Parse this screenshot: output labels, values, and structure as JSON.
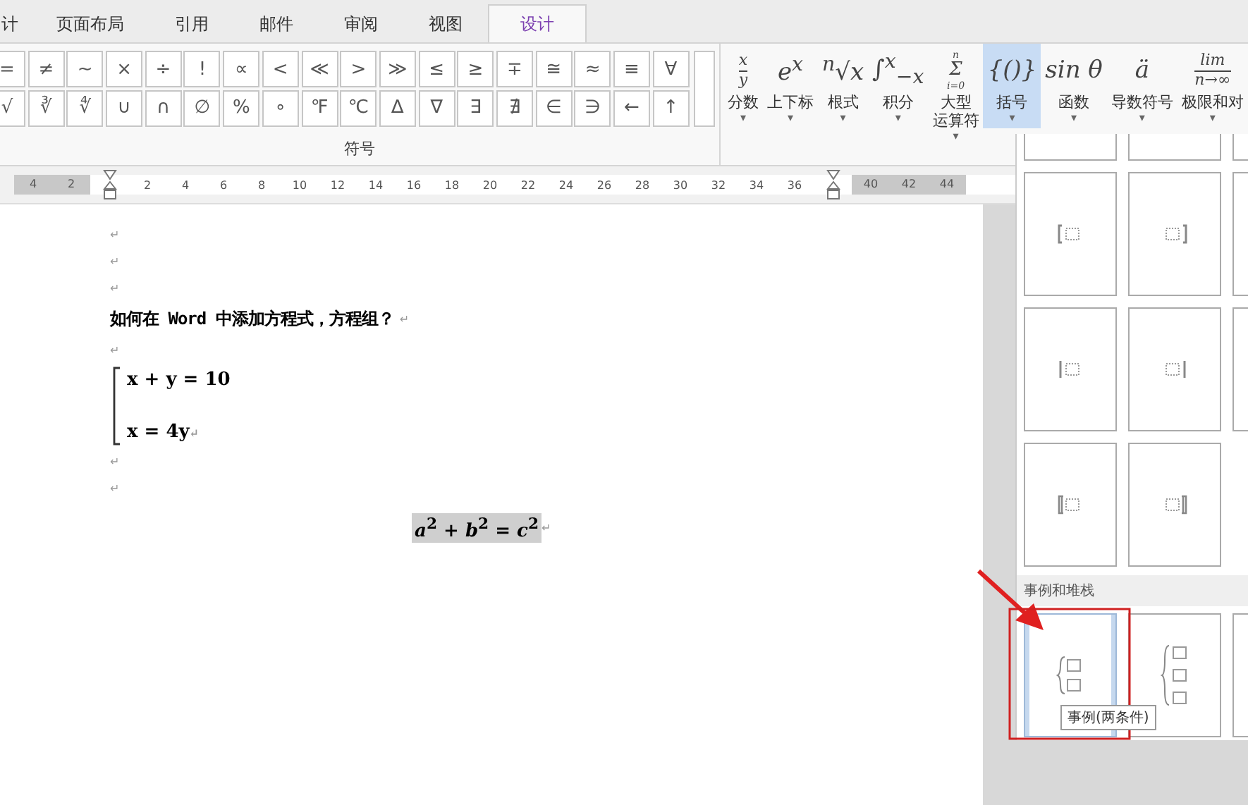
{
  "tabs": [
    {
      "label": "计",
      "selected": false
    },
    {
      "label": "页面布局",
      "selected": false
    },
    {
      "label": "引用",
      "selected": false
    },
    {
      "label": "邮件",
      "selected": false
    },
    {
      "label": "审阅",
      "selected": false
    },
    {
      "label": "视图",
      "selected": false
    },
    {
      "label": "设计",
      "selected": true
    }
  ],
  "symbols": {
    "rows": [
      [
        "=",
        "≠",
        "~",
        "×",
        "÷",
        "!",
        "∝",
        "<",
        "≪",
        ">",
        "≫",
        "≤",
        "≥",
        "∓",
        "≅",
        "≈",
        "≡",
        "∀"
      ],
      [
        "√",
        "∛",
        "∜",
        "∪",
        "∩",
        "∅",
        "%",
        "∘",
        "℉",
        "℃",
        "∆",
        "∇",
        "∃",
        "∄",
        "∈",
        "∋",
        "←",
        "↑"
      ]
    ],
    "group_label": "符号"
  },
  "structures": [
    {
      "kind": "fraction",
      "top": "x",
      "bottom": "y",
      "label": [
        "分数"
      ],
      "caret": "▾",
      "selected": false
    },
    {
      "kind": "inline",
      "glyph": "e$^{x}$",
      "label": [
        "上下标"
      ],
      "caret": "▾",
      "selected": false
    },
    {
      "kind": "inline",
      "glyph": "$^{n}$√x",
      "label": [
        "根式"
      ],
      "caret": "▾",
      "selected": false
    },
    {
      "kind": "inline",
      "glyph": "∫$^{x}$$_{−x}$",
      "label": [
        "积分"
      ],
      "caret": "▾",
      "selected": false
    },
    {
      "kind": "stack",
      "top": "n",
      "mid": "Σ",
      "bottom": "i=0",
      "label": [
        "大型",
        "运算符"
      ],
      "caret": "▾",
      "selected": false
    },
    {
      "kind": "inline",
      "glyph": "{()}",
      "label": [
        "括号"
      ],
      "caret": "▾",
      "selected": true
    },
    {
      "kind": "inline",
      "glyph": "sin θ",
      "label": [
        "函数"
      ],
      "caret": "▾",
      "selected": false
    },
    {
      "kind": "inline",
      "glyph": "ä",
      "label": [
        "导数符号"
      ],
      "caret": "▾",
      "selected": false
    },
    {
      "kind": "fraction",
      "top": "lim",
      "bottom": "n→∞",
      "label": [
        "极限和对"
      ],
      "caret": "▾",
      "selected": false
    }
  ],
  "ruler": [
    {
      "label": "4"
    },
    {
      "label": "2"
    },
    {
      "kind": "marker"
    },
    {
      "label": "2"
    },
    {
      "label": "4"
    },
    {
      "label": "6"
    },
    {
      "label": "8"
    },
    {
      "label": "10"
    },
    {
      "label": "12"
    },
    {
      "label": "14"
    },
    {
      "label": "16"
    },
    {
      "label": "18"
    },
    {
      "label": "20"
    },
    {
      "label": "22"
    },
    {
      "label": "24"
    },
    {
      "label": "26"
    },
    {
      "label": "28"
    },
    {
      "label": "30"
    },
    {
      "label": "32"
    },
    {
      "label": "34"
    },
    {
      "label": "36"
    },
    {
      "kind": "marker"
    },
    {
      "label": "40"
    },
    {
      "label": "42"
    },
    {
      "label": "44"
    }
  ],
  "document": [
    {
      "kind": "empty",
      "mark": "↵"
    },
    {
      "kind": "empty",
      "mark": "↵"
    },
    {
      "kind": "empty",
      "mark": "↵"
    },
    {
      "kind": "heading",
      "text": "如何在 Word 中添加方程式，方程组？",
      "mark": "↵"
    },
    {
      "kind": "empty",
      "mark": "↵"
    },
    {
      "kind": "system",
      "lines": [
        "x + y = 10",
        "x = 4y"
      ],
      "mark": "↵"
    },
    {
      "kind": "empty",
      "mark": "↵"
    },
    {
      "kind": "empty",
      "mark": "↵"
    },
    {
      "kind": "equation",
      "text": "*a*$^{2}$ + *b*$^{2}$ = *c*$^{2}$",
      "mark": "↵",
      "highlighted": true
    }
  ],
  "gallery": {
    "top_row": [
      {
        "kind": "partial"
      },
      {
        "kind": "partial"
      },
      {
        "kind": "partial"
      }
    ],
    "rows": [
      [
        {
          "kind": "left-bracket",
          "selected": false
        },
        {
          "kind": "right-bracket",
          "selected": false
        },
        {
          "kind": "blank",
          "selected": false
        }
      ],
      [
        {
          "kind": "left-bar",
          "selected": false
        },
        {
          "kind": "right-bar",
          "selected": false
        },
        {
          "kind": "blank",
          "selected": false
        }
      ],
      [
        {
          "kind": "left-double",
          "selected": false
        },
        {
          "kind": "right-double",
          "selected": false
        }
      ]
    ],
    "section": "事例和堆栈",
    "section_row": [
      {
        "kind": "cases",
        "selected": true
      },
      {
        "kind": "cases3",
        "selected": false
      },
      {
        "kind": "blank",
        "selected": false
      }
    ],
    "tooltip": "事例(两条件)"
  }
}
